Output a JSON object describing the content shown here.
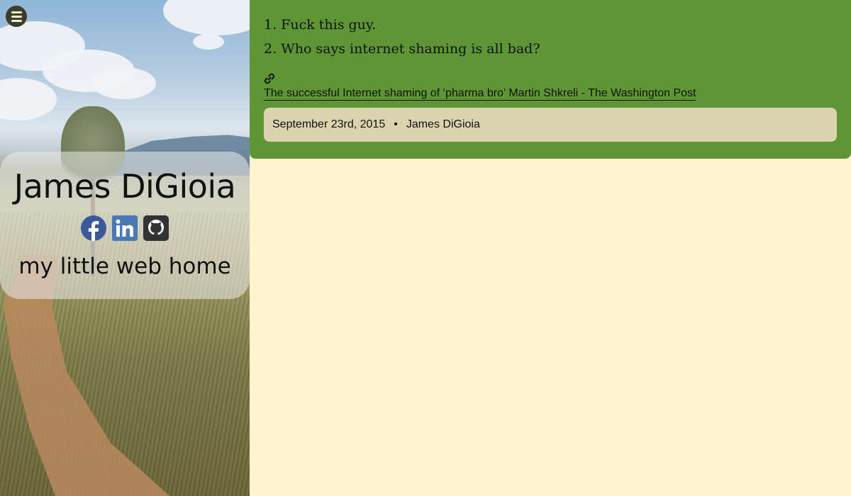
{
  "sidebar": {
    "menu_label": "menu",
    "profile": {
      "name": "James DiGioia",
      "tagline": "my little web home",
      "social": [
        {
          "network": "facebook",
          "icon": "facebook-icon",
          "color": "#3b5998"
        },
        {
          "network": "linkedin",
          "icon": "linkedin-icon",
          "color": "#4a78b5"
        },
        {
          "network": "github",
          "icon": "github-icon",
          "color": "#333333"
        }
      ]
    }
  },
  "post": {
    "list_items": [
      "Fuck this guy.",
      "Who says internet shaming is all bad?"
    ],
    "link": {
      "icon": "link-icon",
      "text": "The successful Internet shaming of ‘pharma bro’ Martin Shkreli - The Washington Post"
    },
    "meta": {
      "date": "September 23rd, 2015",
      "separator": "•",
      "author": "James DiGioia"
    }
  },
  "colors": {
    "page_background": "#fff5cf",
    "post_background": "#5e9636",
    "meta_background": "#dbd2ae",
    "menu_button": "#3a3e2a"
  }
}
